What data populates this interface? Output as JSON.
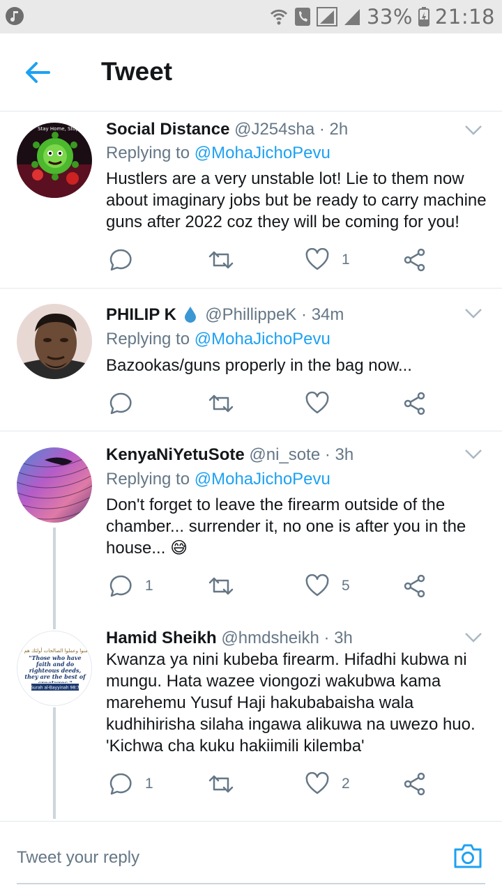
{
  "status_bar": {
    "battery": "33%",
    "time": "21:18"
  },
  "header": {
    "title": "Tweet"
  },
  "tweets": [
    {
      "name": "Social Distance",
      "handle": "@J254sha",
      "time": "· 2h",
      "replying_label": "Replying to",
      "replying_to": "@MohaJichoPevu",
      "text": "Hustlers are a very unstable lot! Lie to them now about imaginary jobs but be ready to carry machine guns after 2022 coz they will be coming for you!",
      "avatar_text": "Stay Home, Stop Sp",
      "replies": "",
      "retweets": "",
      "likes": "1"
    },
    {
      "name": "PHILIP K",
      "handle": "@PhillippeK",
      "time": "· 34m",
      "replying_label": "Replying to",
      "replying_to": "@MohaJichoPevu",
      "text": "Bazookas/guns properly in the bag now...",
      "replies": "",
      "retweets": "",
      "likes": ""
    },
    {
      "name": "KenyaNiYetuSote",
      "handle": "@ni_sote",
      "time": "· 3h",
      "replying_label": "Replying to",
      "replying_to": "@MohaJichoPevu",
      "text": "Don't forget to leave the firearm outside of the chamber... surrender it, no one is after you in the house... 😅",
      "replies": "1",
      "retweets": "",
      "likes": "5"
    },
    {
      "name": "Hamid Sheikh",
      "handle": "@hmdsheikh",
      "time": "· 3h",
      "text": "Kwanza ya nini kubeba firearm. Hifadhi kubwa ni mungu. Hata wazee viongozi wakubwa kama marehemu Yusuf Haji hakubabaisha wala kudhihirisha silaha ingawa alikuwa na  uwezo huo. 'Kichwa cha kuku hakiimili kilemba'",
      "avatar_arabic": "إن الذين آمنوا وعملوا الصالحات أولئك هم خير البرية",
      "avatar_quote": "\"Those who have faith and do righteous deeds, they are the best of creatures.\"",
      "avatar_ref": "[Surah al-Bayyinah 98:7]",
      "replies": "1",
      "retweets": "",
      "likes": "2"
    }
  ],
  "reply_bar": {
    "placeholder": "Tweet your reply"
  },
  "colors": {
    "accent": "#1da1f2",
    "secondary_text": "#657786",
    "icon": "#657786",
    "divider": "#e1e8ed"
  },
  "icons": [
    "music-note-icon",
    "wifi-calling-icon",
    "phone-icon",
    "signal-icon",
    "battery-icon",
    "back-arrow-icon",
    "chevron-down-icon",
    "reply-icon",
    "retweet-icon",
    "like-icon",
    "share-icon",
    "camera-icon",
    "water-drop-icon"
  ]
}
